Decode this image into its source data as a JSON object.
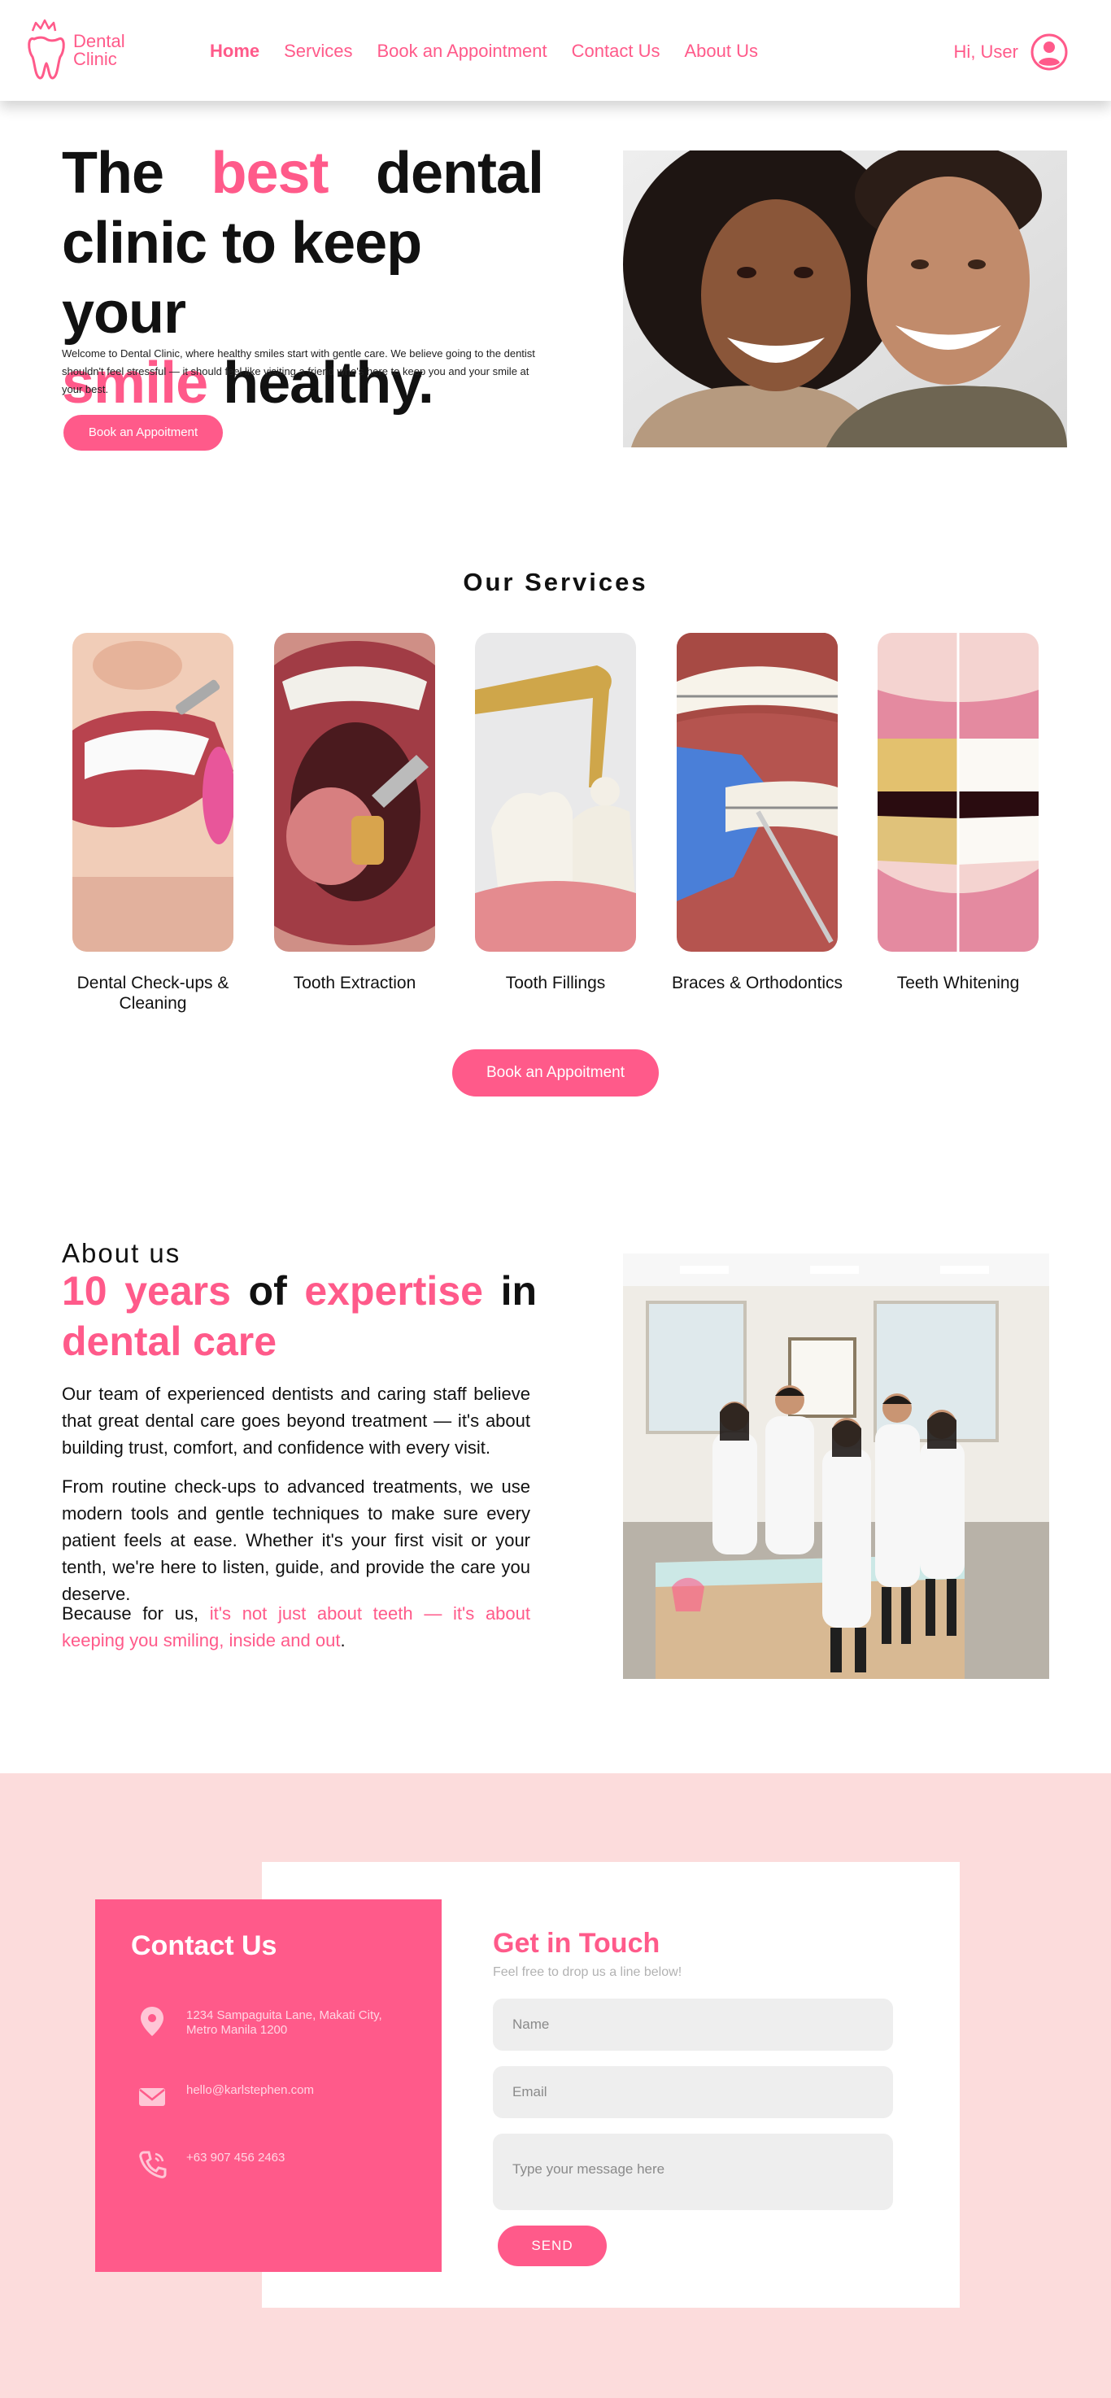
{
  "brand": {
    "name_line1": "Dental",
    "name_line2": "Clinic",
    "accent_color": "#ff5a8a",
    "contact_bg_color": "#fcdcdc"
  },
  "nav": {
    "items": [
      {
        "label": "Home",
        "active": true
      },
      {
        "label": "Services",
        "active": false
      },
      {
        "label": "Book an Appointment",
        "active": false
      },
      {
        "label": "Contact Us",
        "active": false
      },
      {
        "label": "About Us",
        "active": false
      }
    ],
    "greeting": "Hi, User",
    "user_icon": "user-circle-icon"
  },
  "hero": {
    "title": {
      "w1": "The",
      "w2": "best",
      "w3": "dental",
      "line2": "clinic to keep your",
      "w4": "smile",
      "w5": "healthy."
    },
    "description": "Welcome to Dental Clinic, where healthy smiles start with gentle care. We believe going to the dentist shouldn't feel stressful — it should feel like visiting a friend who's here to keep you and your smile at your best.",
    "button_label": "Book an Appoitment"
  },
  "services": {
    "title": "Our Services",
    "items": [
      {
        "label": "Dental Check-ups & Cleaning"
      },
      {
        "label": "Tooth Extraction"
      },
      {
        "label": "Tooth Fillings"
      },
      {
        "label": "Braces & Orthodontics"
      },
      {
        "label": "Teeth Whitening"
      }
    ],
    "button_label": "Book an Appoitment"
  },
  "about": {
    "small_title": "About us",
    "title": {
      "w1": "10",
      "w2": "years",
      "w3": "of",
      "w4": "expertise",
      "w5": "in",
      "line2": "dental care"
    },
    "p1": "Our team of experienced dentists and caring staff believe that great dental care goes beyond treatment — it's about building trust, comfort, and confidence with every visit.",
    "p2": "From routine check-ups to advanced treatments, we use modern tools and gentle techniques to make sure every patient feels at ease. Whether it's your first visit or your tenth, we're here to listen, guide, and provide the care you deserve.",
    "p3_lead": "Because for us,",
    "p3_pink": "it's not just about teeth — it's about keeping you smiling, inside and out",
    "p3_end": "."
  },
  "contact": {
    "panel_title": "Contact Us",
    "address": "1234 Sampaguita Lane, Makati City, Metro Manila 1200",
    "email": "hello@karlstephen.com",
    "phone": "+63 907 456 2463",
    "form_title": "Get in Touch",
    "form_subtitle": "Feel free to drop us a line below!",
    "name_placeholder": "Name",
    "email_placeholder": "Email",
    "message_placeholder": "Type your message here",
    "send_label": "SEND"
  }
}
